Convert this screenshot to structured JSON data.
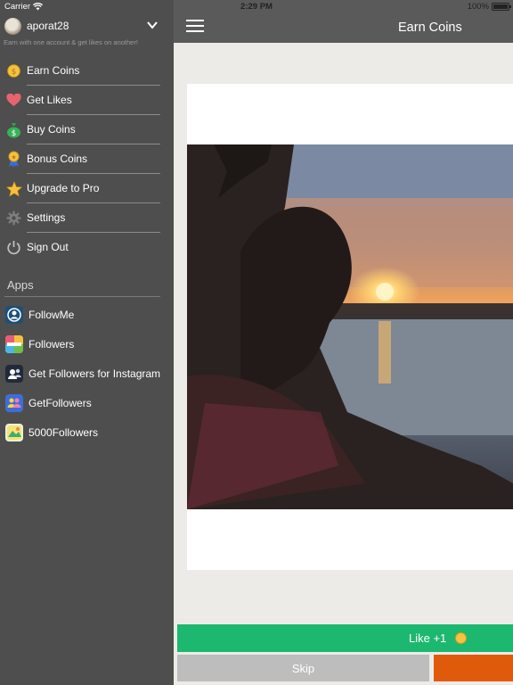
{
  "status": {
    "carrier": "Carrier",
    "time": "2:29 PM",
    "battery": "100%",
    "wifi_icon": "wifi-icon",
    "battery_level": 1.0
  },
  "sidebar": {
    "username": "aporat28",
    "tagline": "Earn with one account & get likes on another!",
    "menu": [
      {
        "label": "Earn Coins",
        "icon": "coin-icon"
      },
      {
        "label": "Get Likes",
        "icon": "heart-icon"
      },
      {
        "label": "Buy Coins",
        "icon": "money-bag-icon"
      },
      {
        "label": "Bonus Coins",
        "icon": "medal-icon"
      },
      {
        "label": "Upgrade to Pro",
        "icon": "star-icon"
      },
      {
        "label": "Settings",
        "icon": "gear-icon"
      },
      {
        "label": "Sign Out",
        "icon": "power-icon"
      }
    ],
    "apps_header": "Apps",
    "apps": [
      {
        "label": "FollowMe",
        "icon": "followme-app-icon"
      },
      {
        "label": "Followers",
        "icon": "followers-app-icon"
      },
      {
        "label": "Get Followers for Instagram",
        "icon": "get-followers-instagram-app-icon"
      },
      {
        "label": "GetFollowers",
        "icon": "getfollowers-app-icon"
      },
      {
        "label": "5000Followers",
        "icon": "5000followers-app-icon"
      }
    ]
  },
  "main": {
    "title": "Earn Coins",
    "like_label": "Like +1",
    "skip_label": "Skip"
  },
  "colors": {
    "sidebar_bg": "#4e4e4e",
    "topbar_bg": "#5a5a5a",
    "like_green": "#1db870",
    "skip_gray": "#bdbdbd",
    "orange": "#e05a0c",
    "coin_gold": "#f5c242"
  }
}
